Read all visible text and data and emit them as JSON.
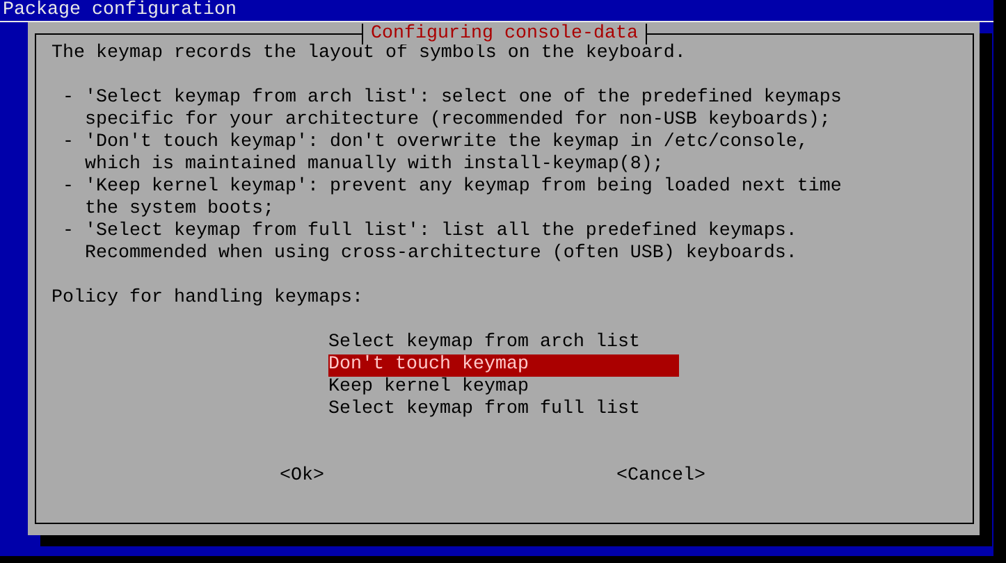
{
  "window": {
    "title": "Package configuration"
  },
  "dialog": {
    "title": "Configuring console-data",
    "intro": "The keymap records the layout of symbols on the keyboard.",
    "bullets": [
      {
        "lines": [
          "- 'Select keymap from arch list': select one of the predefined keymaps",
          "specific for your architecture (recommended for non-USB keyboards);"
        ]
      },
      {
        "lines": [
          "- 'Don't touch keymap': don't overwrite the keymap in /etc/console,",
          "which is maintained manually with install-keymap(8);"
        ]
      },
      {
        "lines": [
          "- 'Keep kernel keymap': prevent any keymap from being loaded next time",
          "the system boots;"
        ]
      },
      {
        "lines": [
          "- 'Select keymap from full list': list all the predefined keymaps.",
          "Recommended when using cross-architecture (often USB) keyboards."
        ]
      }
    ],
    "prompt": "Policy for handling keymaps:",
    "options": [
      {
        "label": "Select keymap from arch list",
        "selected": false
      },
      {
        "label": "Don't touch keymap",
        "selected": true
      },
      {
        "label": "Keep kernel keymap",
        "selected": false
      },
      {
        "label": "Select keymap from full list",
        "selected": false
      }
    ],
    "buttons": [
      {
        "label": "<Ok>"
      },
      {
        "label": "<Cancel>"
      }
    ]
  }
}
